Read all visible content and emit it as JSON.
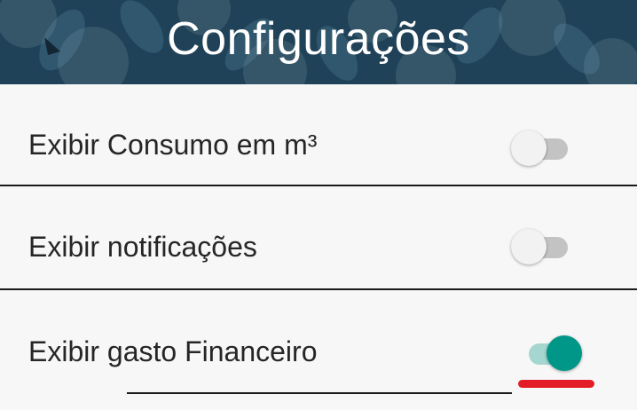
{
  "header": {
    "title": "Configurações"
  },
  "settings": [
    {
      "label": "Exibir Consumo em m³",
      "enabled": false
    },
    {
      "label": "Exibir notificações",
      "enabled": false
    },
    {
      "label": "Exibir gasto Financeiro",
      "enabled": true
    }
  ],
  "colors": {
    "header_background": "#1f4258",
    "switch_on": "#009688",
    "switch_on_track": "#a5d6d0",
    "switch_off_track": "#c3c3c3",
    "highlight_underline": "#e31d27"
  }
}
